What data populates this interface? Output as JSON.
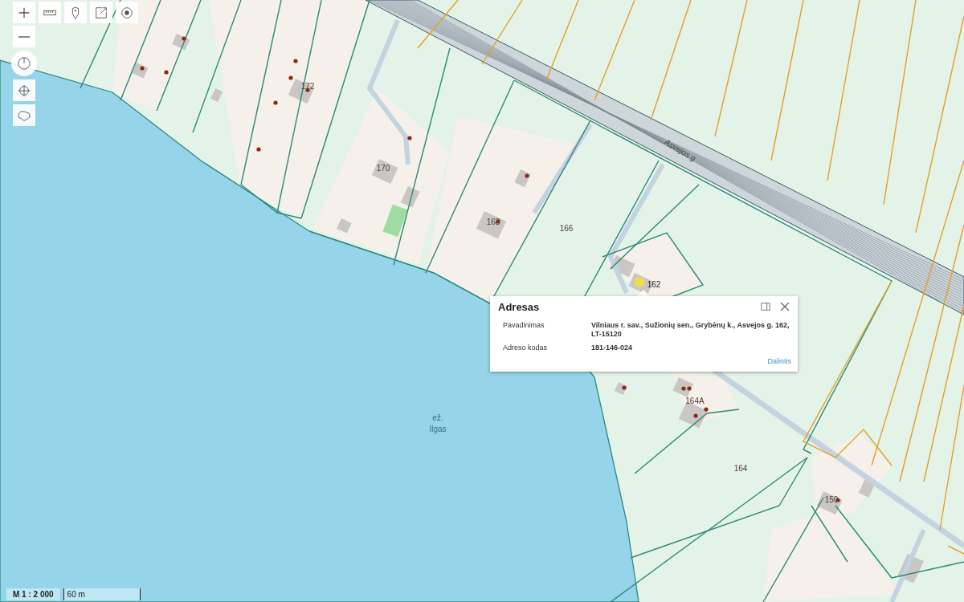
{
  "map": {
    "labels": [
      {
        "kind": "number",
        "text": "172"
      },
      {
        "kind": "number",
        "text": "170"
      },
      {
        "kind": "number",
        "text": "168"
      },
      {
        "kind": "number",
        "text": "166"
      },
      {
        "kind": "number",
        "text": "162"
      },
      {
        "kind": "number",
        "text": "164A"
      },
      {
        "kind": "number",
        "text": "164"
      },
      {
        "kind": "number",
        "text": "150"
      },
      {
        "kind": "street",
        "text": "Asvejos g"
      },
      {
        "kind": "water",
        "text": "ež."
      },
      {
        "kind": "water",
        "text": "Ilgas"
      }
    ]
  },
  "popup": {
    "title": "Adresas",
    "rows": [
      {
        "label": "Pavadinimas",
        "value": "Vilniaus r. sav., Sužionių sen., Grybėnų k., Asvejos g. 162, LT-15120"
      },
      {
        "label": "Adreso kodas",
        "value": "181-146-024"
      }
    ],
    "link": "Dalintis"
  },
  "scale": {
    "ratio": "M 1 : 2 000",
    "distance": "60 m"
  }
}
